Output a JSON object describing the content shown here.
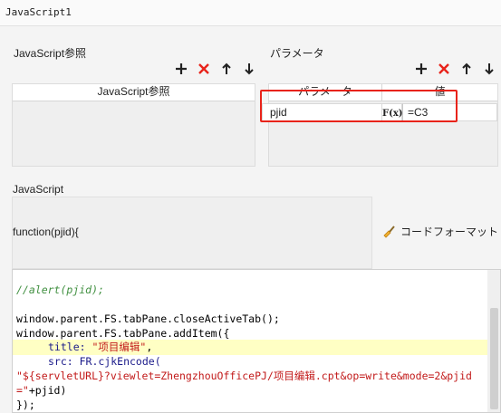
{
  "window": {
    "title": "JavaScript1"
  },
  "left_panel": {
    "label": "JavaScript参照",
    "column_header": "JavaScript参照"
  },
  "right_panel": {
    "label": "パラメータ",
    "headers": [
      "パラメータ",
      "値"
    ],
    "rows": [
      {
        "name": "pjid",
        "formula_icon": "F(x)",
        "value": "=C3"
      }
    ]
  },
  "toolbar": {
    "add": "+",
    "remove": "×",
    "up": "↑",
    "down": "↓"
  },
  "js_section": {
    "label": "JavaScript",
    "signature": "function(pjid){",
    "format_button": "コードフォーマット"
  },
  "code": {
    "l1": "//alert(pjid);",
    "l2": "window.parent.FS.tabPane.closeActiveTab();",
    "l3": "window.parent.FS.tabPane.addItem({",
    "l4_key": "title: ",
    "l4_val": "\"项目编辑\"",
    "l4_end": ",",
    "l5": "src: FR.cjkEncode(",
    "l6": "\"${servletURL}?viewlet=ZhengzhouOfficePJ/项目编辑.cpt&op=write&mode=2&pjid",
    "l7_a": "=\"",
    "l7_b": "+pjid)",
    "l8": "});"
  },
  "colors": {
    "accent_red": "#e8231a",
    "highlight_line": "#ffffc4",
    "comment": "#3f8f3f",
    "string": "#c21a1a"
  }
}
